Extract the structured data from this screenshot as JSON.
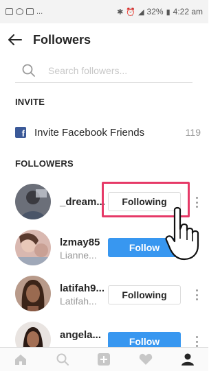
{
  "status_bar": {
    "battery": "32%",
    "time": "4:22 am",
    "left_icons": [
      "gallery-icon",
      "whatsapp-icon",
      "camera-icon"
    ],
    "left_more": "..."
  },
  "header": {
    "title": "Followers",
    "back_icon": "back-arrow-icon"
  },
  "search": {
    "placeholder": "Search followers..."
  },
  "invite": {
    "section_label": "INVITE",
    "item_label": "Invite Facebook Friends",
    "count": "119"
  },
  "followers": {
    "section_label": "FOLLOWERS",
    "rows": [
      {
        "username": "_dream...",
        "fullname": "",
        "button": "Following",
        "state": "following"
      },
      {
        "username": "lzmay85",
        "fullname": "Lianne...",
        "button": "Follow",
        "state": "follow"
      },
      {
        "username": "latifah9...",
        "fullname": "Latifah...",
        "button": "Following",
        "state": "following"
      },
      {
        "username": "angela...",
        "fullname": "",
        "button": "Follow",
        "state": "follow"
      }
    ]
  },
  "bottom_nav": {
    "items": [
      "home-icon",
      "search-icon",
      "add-post-icon",
      "activity-heart-icon",
      "profile-icon"
    ],
    "active": "profile-icon"
  },
  "colors": {
    "follow_blue": "#3897f0",
    "highlight_pink": "#e63967",
    "facebook_blue": "#3b5998",
    "muted_text": "#999999"
  }
}
